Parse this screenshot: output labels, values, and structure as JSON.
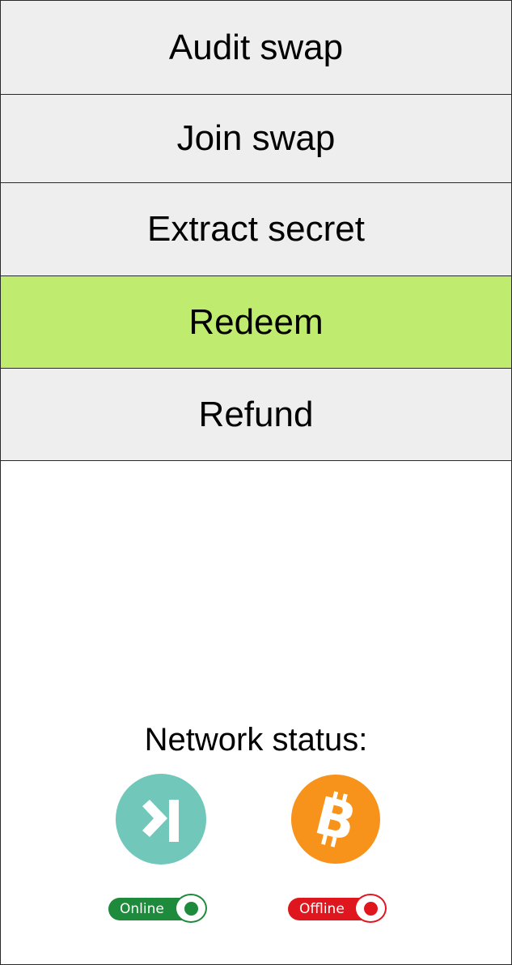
{
  "menu": {
    "items": [
      {
        "label": "Audit swap",
        "active": false
      },
      {
        "label": "Join swap",
        "active": false
      },
      {
        "label": "Extract secret",
        "active": false
      },
      {
        "label": "Redeem",
        "active": true
      },
      {
        "label": "Refund",
        "active": false
      }
    ]
  },
  "network": {
    "title": "Network status:",
    "kaspa": {
      "icon": "kaspa-logo-icon",
      "status": "Online",
      "color": "#1e8a3c",
      "logo_color": "#70c7ba"
    },
    "bitcoin": {
      "icon": "bitcoin-logo-icon",
      "status": "Offline",
      "color": "#e0161e",
      "logo_color": "#f7931a"
    }
  },
  "colors": {
    "menu_bg": "#eeeeee",
    "menu_active": "#bfeb6e",
    "border": "#2a2a2a"
  }
}
